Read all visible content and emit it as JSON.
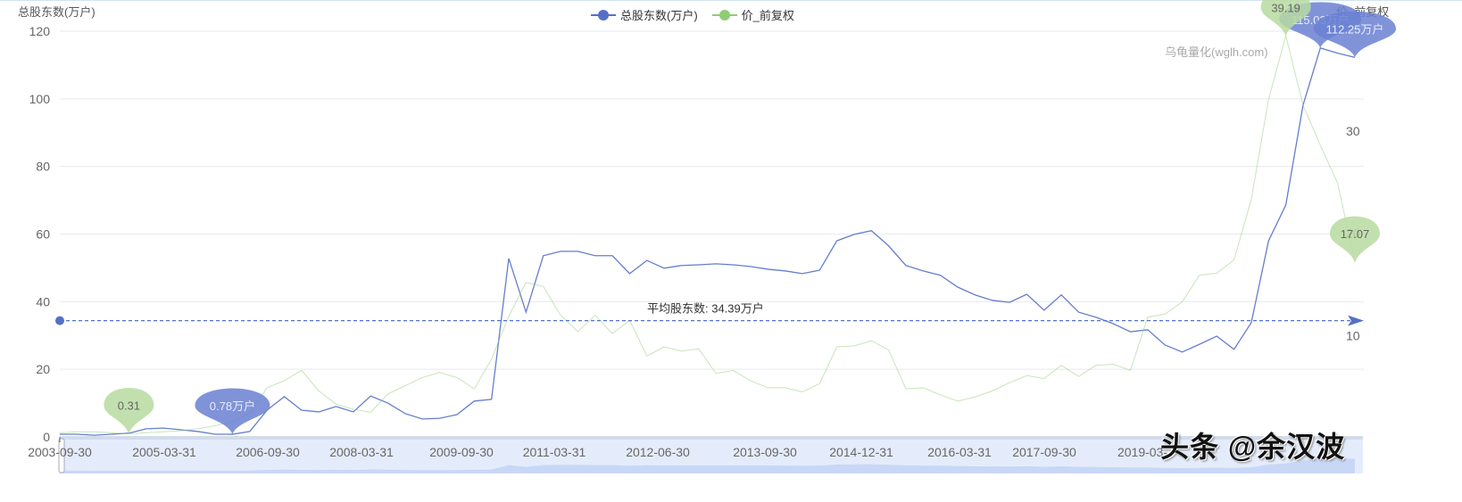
{
  "chart_data": {
    "type": "line",
    "title": "",
    "left_axis": {
      "name": "总股东数(万户)",
      "ticks": [
        0,
        20,
        40,
        60,
        80,
        100,
        120
      ],
      "ylim": [
        0,
        120
      ]
    },
    "right_axis": {
      "name": "价_前复权",
      "ticks": [
        10,
        20,
        30
      ],
      "ylim": [
        0,
        40
      ]
    },
    "x_tick_labels": [
      "2003-09-30",
      "2005-03-31",
      "2006-09-30",
      "2008-03-31",
      "2009-09-30",
      "2011-03-31",
      "2012-06-30",
      "2013-09-30",
      "2014-12-31",
      "2016-03-31",
      "2017-09-30",
      "2019-03-"
    ],
    "legend": {
      "placement": "top-center",
      "items": [
        "总股东数(万户)",
        "价_前复权"
      ]
    },
    "series": [
      {
        "name": "总股东数(万户)",
        "axis": "left",
        "color": "#5470c6",
        "values": [
          0.8,
          0.8,
          0.5,
          0.8,
          1.1,
          2.4,
          2.6,
          2.1,
          1.6,
          0.8,
          0.78,
          1.6,
          7.9,
          11.9,
          7.9,
          7.4,
          9.0,
          7.4,
          12.1,
          10.0,
          6.9,
          5.3,
          5.5,
          6.6,
          10.6,
          11.1,
          52.8,
          36.9,
          53.6,
          54.9,
          54.9,
          53.6,
          53.6,
          48.3,
          52.2,
          49.9,
          50.7,
          50.9,
          51.2,
          50.9,
          50.4,
          49.6,
          49.1,
          48.3,
          49.3,
          58.0,
          59.9,
          61.0,
          56.5,
          50.7,
          49.1,
          47.8,
          44.3,
          42.0,
          40.4,
          39.8,
          42.2,
          37.5,
          42.0,
          36.9,
          35.4,
          33.5,
          31.1,
          31.7,
          27.2,
          25.1,
          27.4,
          29.8,
          25.9,
          33.8,
          58.0,
          68.6,
          98.2,
          115.03,
          113.5,
          112.25
        ]
      },
      {
        "name": "价_前复权",
        "axis": "right",
        "color": "#91cc75",
        "values": [
          0.4,
          0.5,
          0.5,
          0.4,
          0.31,
          0.4,
          0.5,
          0.6,
          0.8,
          1.1,
          1.5,
          2.3,
          4.8,
          5.5,
          6.5,
          4.5,
          3.2,
          2.7,
          2.4,
          4.2,
          5.0,
          5.8,
          6.3,
          5.8,
          4.7,
          7.6,
          11.8,
          15.1,
          14.7,
          11.9,
          10.3,
          11.9,
          10.1,
          11.4,
          7.9,
          8.8,
          8.4,
          8.6,
          6.2,
          6.5,
          5.5,
          4.8,
          4.8,
          4.4,
          5.2,
          8.8,
          8.9,
          9.4,
          8.5,
          4.7,
          4.8,
          4.1,
          3.5,
          3.9,
          4.5,
          5.3,
          6.0,
          5.7,
          7.0,
          5.9,
          7.0,
          7.1,
          6.5,
          11.7,
          12.0,
          13.2,
          15.8,
          16.0,
          17.3,
          23.2,
          33.0,
          39.19,
          32.4,
          28.5,
          24.8,
          17.07
        ]
      }
    ],
    "mark_points": [
      {
        "series": 0,
        "index": 10,
        "label": "0.78万户",
        "type": "min"
      },
      {
        "series": 0,
        "index": 73,
        "label": "115.03万户",
        "type": "max"
      },
      {
        "series": 0,
        "index": 75,
        "label": "112.25万户",
        "type": "last"
      },
      {
        "series": 1,
        "index": 4,
        "label": "0.31",
        "type": "min"
      },
      {
        "series": 1,
        "index": 71,
        "label": "39.19",
        "type": "max"
      },
      {
        "series": 1,
        "index": 75,
        "label": "17.07",
        "type": "last"
      }
    ],
    "mark_line": {
      "label": "平均股东数: 34.39万户",
      "value": 34.39,
      "axis": "left"
    }
  },
  "watermark_site": "乌龟量化(wglh.com)",
  "watermark_author": "头条 @余汉波"
}
